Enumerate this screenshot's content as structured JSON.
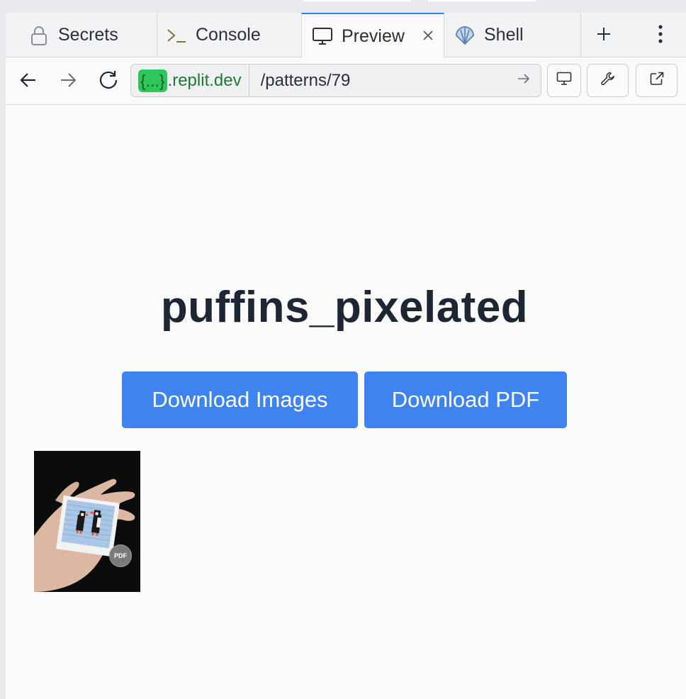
{
  "tabs": [
    {
      "label": "Secrets",
      "icon": "lock-icon"
    },
    {
      "label": "Console",
      "icon": "terminal-icon"
    },
    {
      "label": "Preview",
      "icon": "monitor-icon",
      "active": true
    },
    {
      "label": "Shell",
      "icon": "shell-icon"
    }
  ],
  "tabbar": {
    "add_icon": "plus-icon",
    "menu_icon": "more-vertical-icon"
  },
  "urlbar": {
    "domain_badge": "{...}",
    "domain_suffix": ".replit.dev",
    "path": "/patterns/79"
  },
  "page": {
    "title": "puffins_pixelated",
    "download_images_label": "Download Images",
    "download_pdf_label": "Download PDF",
    "thumbnail_badge": "PDF"
  },
  "colors": {
    "accent_blue": "#3f83ee",
    "domain_green": "#2ec55a",
    "title_text": "#1e2633"
  }
}
